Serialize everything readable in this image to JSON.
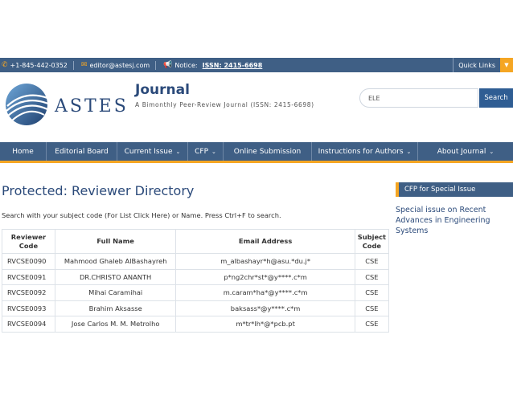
{
  "topbar": {
    "phone": "+1-845-442-0352",
    "email": "editor@astesj.com",
    "notice_label": "Notice:",
    "issn": "ISSN: 2415-6698",
    "quick_links": "Quick Links"
  },
  "header": {
    "brand": "ASTES",
    "journal_title": "Journal",
    "tagline": "A Bimonthly Peer-Review Journal (ISSN: 2415-6698)",
    "search_value": "ELE",
    "search_button": "Search"
  },
  "nav": {
    "items": [
      {
        "label": "Home",
        "dropdown": false
      },
      {
        "label": "Editorial Board",
        "dropdown": false
      },
      {
        "label": "Current Issue",
        "dropdown": true
      },
      {
        "label": "CFP",
        "dropdown": true
      },
      {
        "label": "Online Submission",
        "dropdown": false
      },
      {
        "label": "Instructions for Authors",
        "dropdown": true
      },
      {
        "label": "About Journal",
        "dropdown": true
      }
    ]
  },
  "main": {
    "title": "Protected: Reviewer Directory",
    "instructions": "Search with your subject code (For List Click Here) or Name. Press Ctrl+F to search.",
    "table": {
      "headers": [
        "Reviewer Code",
        "Full Name",
        "Email Address",
        "Subject Code"
      ],
      "rows": [
        [
          "RVCSE0090",
          "Mahmood Ghaleb AlBashayreh",
          "m_albashayr*h@asu.*du.j*",
          "CSE"
        ],
        [
          "RVCSE0091",
          "DR.CHRISTO ANANTH",
          "p*ng2chr*st*@y****.c*m",
          "CSE"
        ],
        [
          "RVCSE0092",
          "Mihai Caramihai",
          "m.caram*ha*@y****.c*m",
          "CSE"
        ],
        [
          "RVCSE0093",
          "Brahim Aksasse",
          "baksass*@y****.c*m",
          "CSE"
        ],
        [
          "RVCSE0094",
          "Jose Carlos M. M. Metrolho",
          "m*tr*lh*@*pcb.pt",
          "CSE"
        ]
      ]
    }
  },
  "sidebar": {
    "heading": "CFP for Special Issue",
    "link": "Special issue on Recent Advances in Engineering Systems"
  },
  "colors": {
    "brand_blue": "#3f5f85",
    "accent_orange": "#f5a623",
    "title_blue": "#2b4a7a"
  },
  "icons": [
    "phone-icon",
    "mail-icon",
    "megaphone-icon",
    "caret-down-icon"
  ]
}
